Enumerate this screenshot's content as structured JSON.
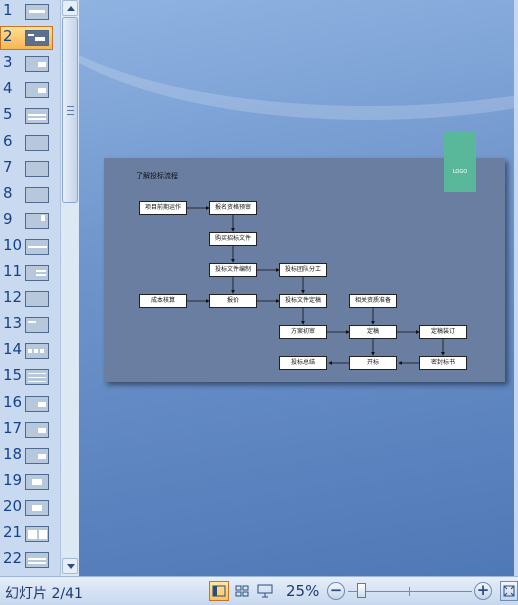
{
  "slides_panel": {
    "thumbnails": [
      {
        "number": "1",
        "variant": "title",
        "selected": false
      },
      {
        "number": "2",
        "variant": "dark",
        "selected": true
      },
      {
        "number": "3",
        "variant": "box-right",
        "selected": false
      },
      {
        "number": "4",
        "variant": "box-right",
        "selected": false
      },
      {
        "number": "5",
        "variant": "table",
        "selected": false
      },
      {
        "number": "6",
        "variant": "blank",
        "selected": false
      },
      {
        "number": "7",
        "variant": "blank",
        "selected": false
      },
      {
        "number": "8",
        "variant": "blank",
        "selected": false
      },
      {
        "number": "9",
        "variant": "logo",
        "selected": false
      },
      {
        "number": "10",
        "variant": "line",
        "selected": false
      },
      {
        "number": "11",
        "variant": "lines",
        "selected": false
      },
      {
        "number": "12",
        "variant": "blank",
        "selected": false
      },
      {
        "number": "13",
        "variant": "corner",
        "selected": false
      },
      {
        "number": "14",
        "variant": "dots",
        "selected": false
      },
      {
        "number": "15",
        "variant": "grid",
        "selected": false
      },
      {
        "number": "16",
        "variant": "box-right",
        "selected": false
      },
      {
        "number": "17",
        "variant": "box-right",
        "selected": false
      },
      {
        "number": "18",
        "variant": "box-right",
        "selected": false
      },
      {
        "number": "19",
        "variant": "box-center",
        "selected": false
      },
      {
        "number": "20",
        "variant": "box-center",
        "selected": false
      },
      {
        "number": "21",
        "variant": "split",
        "selected": false
      },
      {
        "number": "22",
        "variant": "table",
        "selected": false
      }
    ]
  },
  "slide": {
    "title": "了解投标流程",
    "logo": "LOGO",
    "nodes": {
      "project_preparation": "项目前期运作",
      "registration_prequalification": "报名资格预审",
      "purchase_bid_docs": "购买招标文件",
      "bid_doc_preparation": "投标文件编制",
      "bid_team_division": "投标团队分工",
      "cost_estimate": "成本核算",
      "quotation": "报价",
      "bid_doc_final": "投标文件定稿",
      "related_materials": "相关资质准备",
      "plan_review": "方案初审",
      "final_draft": "定稿",
      "final_binding": "定稿装订",
      "post_bid_summary": "投标总结",
      "bid_opening": "开标",
      "sealed_delivery": "密封标书"
    }
  },
  "status_bar": {
    "slide_indicator": "幻灯片 2/41",
    "zoom_level": "25%",
    "zoom_out_label": "−",
    "zoom_in_label": "+"
  },
  "colors": {
    "slide_background": "#6a7ea2",
    "logo_block": "#5ab89a",
    "selected_thumbnail": "#f8b552",
    "workspace": "#6f95cc"
  }
}
